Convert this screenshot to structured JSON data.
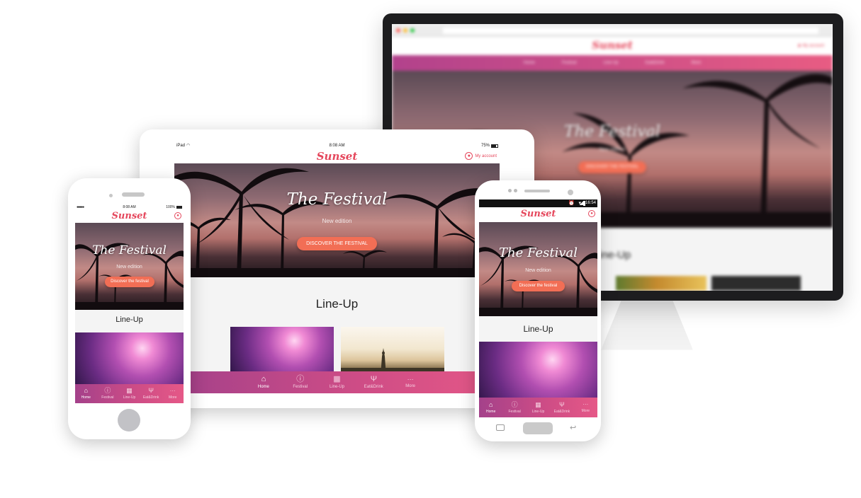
{
  "brand": {
    "logo_text": "Sunset",
    "logo_color": "#e5475c",
    "accent_color": "#f26e55",
    "nav_gradient": [
      "#a4418a",
      "#e55887"
    ]
  },
  "hero": {
    "title": "The Festival",
    "subtitle": "New edition",
    "cta_tablet": "DISCOVER THE FESTIVAL",
    "cta_phone": "Discover the festival"
  },
  "lineup": {
    "title": "Line-Up"
  },
  "tablet": {
    "status_carrier": "iPad",
    "status_time": "8:08 AM",
    "status_battery": "75%",
    "account_label": "My account",
    "account_icon": "user-circle-icon"
  },
  "iphone": {
    "status_carrier": "●●●●● ",
    "status_time": "8:08 AM",
    "status_battery": "100%",
    "account_icon": "user-circle-icon"
  },
  "android": {
    "status_time": "16:54",
    "status_icons": [
      "alarm-icon",
      "wifi-icon",
      "signal-icon",
      "battery-icon"
    ],
    "account_icon": "user-circle-icon"
  },
  "desktop": {
    "account_label": "My account",
    "nav_items": [
      "Home",
      "Festival",
      "Line-Up",
      "Eat&Drink",
      "More"
    ]
  },
  "bottom_nav": {
    "items": [
      {
        "label": "Home",
        "icon": "home-icon",
        "glyph": "⌂",
        "active": true
      },
      {
        "label": "Festival",
        "icon": "info-icon",
        "glyph": "ⓘ",
        "active": false
      },
      {
        "label": "Line-Up",
        "icon": "calendar-icon",
        "glyph": "▦",
        "active": false
      },
      {
        "label": "Eat&Drink",
        "icon": "cutlery-icon",
        "glyph": "Ψ",
        "active": false
      },
      {
        "label": "More",
        "icon": "more-dots-icon",
        "glyph": "···",
        "active": false
      }
    ]
  }
}
